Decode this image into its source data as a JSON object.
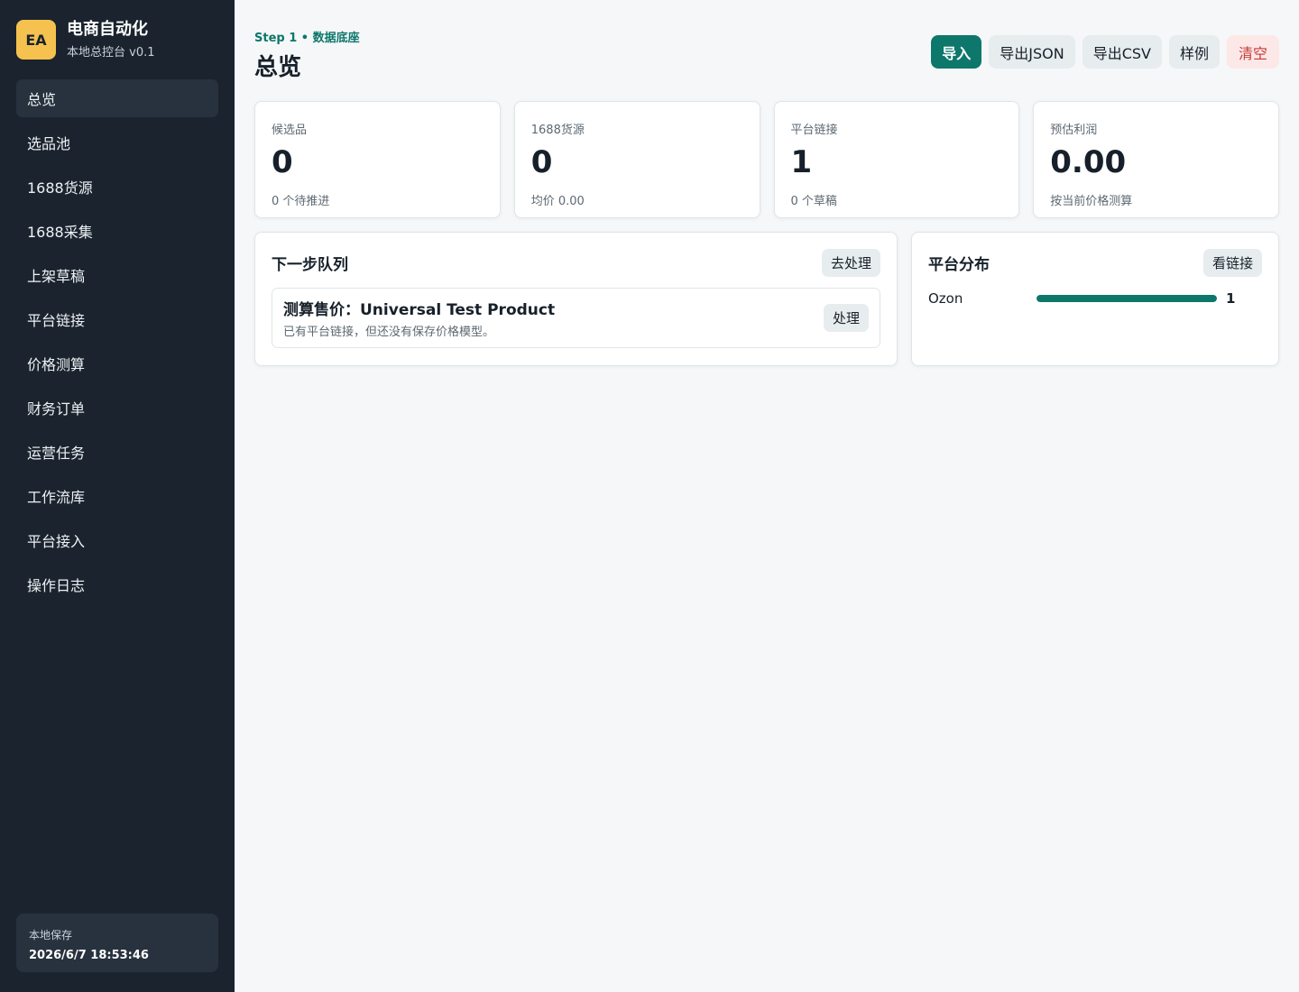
{
  "sidebar": {
    "brand": {
      "mark": "EA",
      "title": "电商自动化",
      "subtitle": "本地总控台 v0.1"
    },
    "items": [
      {
        "label": "总览",
        "active": true
      },
      {
        "label": "选品池",
        "active": false
      },
      {
        "label": "1688货源",
        "active": false
      },
      {
        "label": "1688采集",
        "active": false
      },
      {
        "label": "上架草稿",
        "active": false
      },
      {
        "label": "平台链接",
        "active": false
      },
      {
        "label": "价格测算",
        "active": false
      },
      {
        "label": "财务订单",
        "active": false
      },
      {
        "label": "运营任务",
        "active": false
      },
      {
        "label": "工作流库",
        "active": false
      },
      {
        "label": "平台接入",
        "active": false
      },
      {
        "label": "操作日志",
        "active": false
      }
    ],
    "save": {
      "label": "本地保存",
      "time": "2026/6/7 18:53:46"
    }
  },
  "header": {
    "eyebrow": "Step 1 • 数据底座",
    "title": "总览",
    "actions": {
      "import": "导入",
      "export_json": "导出JSON",
      "export_csv": "导出CSV",
      "sample": "样例",
      "clear": "清空"
    }
  },
  "stats": [
    {
      "label": "候选品",
      "value": "0",
      "note": "0 个待推进"
    },
    {
      "label": "1688货源",
      "value": "0",
      "note": "均价 0.00"
    },
    {
      "label": "平台链接",
      "value": "1",
      "note": "0 个草稿"
    },
    {
      "label": "预估利润",
      "value": "0.00",
      "note": "按当前价格测算"
    }
  ],
  "queue": {
    "title": "下一步队列",
    "action": "去处理",
    "tasks": [
      {
        "title": "测算售价：Universal Test Product",
        "description": "已有平台链接，但还没有保存价格模型。",
        "action": "处理"
      }
    ]
  },
  "platforms": {
    "title": "平台分布",
    "action": "看链接",
    "items": [
      {
        "name": "Ozon",
        "count": "1",
        "share": 1.0
      }
    ]
  },
  "colors": {
    "sidebar": "#1a232e",
    "accent": "#0d776b",
    "brand_mark": "#f5c24f",
    "danger_text": "#c53b36",
    "danger_bg": "#fde8e8"
  }
}
